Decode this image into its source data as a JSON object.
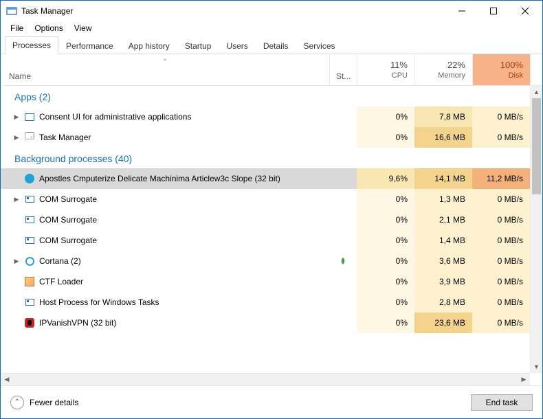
{
  "window": {
    "title": "Task Manager"
  },
  "menu": {
    "file": "File",
    "options": "Options",
    "view": "View"
  },
  "tabs": {
    "processes": "Processes",
    "performance": "Performance",
    "apphistory": "App history",
    "startup": "Startup",
    "users": "Users",
    "details": "Details",
    "services": "Services"
  },
  "columns": {
    "name": "Name",
    "status": "St...",
    "cpu_pct": "11%",
    "cpu_lbl": "CPU",
    "mem_pct": "22%",
    "mem_lbl": "Memory",
    "disk_pct": "100%",
    "disk_lbl": "Disk"
  },
  "groups": {
    "apps": "Apps (2)",
    "bg": "Background processes (40)"
  },
  "rows": {
    "consent": {
      "name": "Consent UI for administrative applications",
      "cpu": "0%",
      "mem": "7,8 MB",
      "disk": "0 MB/s"
    },
    "tm": {
      "name": "Task Manager",
      "cpu": "0%",
      "mem": "16,6 MB",
      "disk": "0 MB/s"
    },
    "apostles": {
      "name": "Apostles Cmputerize Delicate Machinima Articlew3c Slope (32 bit)",
      "cpu": "9,6%",
      "mem": "14,1 MB",
      "disk": "11,2 MB/s"
    },
    "com1": {
      "name": "COM Surrogate",
      "cpu": "0%",
      "mem": "1,3 MB",
      "disk": "0 MB/s"
    },
    "com2": {
      "name": "COM Surrogate",
      "cpu": "0%",
      "mem": "2,1 MB",
      "disk": "0 MB/s"
    },
    "com3": {
      "name": "COM Surrogate",
      "cpu": "0%",
      "mem": "1,4 MB",
      "disk": "0 MB/s"
    },
    "cortana": {
      "name": "Cortana (2)",
      "cpu": "0%",
      "mem": "3,6 MB",
      "disk": "0 MB/s"
    },
    "ctf": {
      "name": "CTF Loader",
      "cpu": "0%",
      "mem": "3,9 MB",
      "disk": "0 MB/s"
    },
    "host": {
      "name": "Host Process for Windows Tasks",
      "cpu": "0%",
      "mem": "2,8 MB",
      "disk": "0 MB/s"
    },
    "ipv": {
      "name": "IPVanishVPN (32 bit)",
      "cpu": "0%",
      "mem": "23,6 MB",
      "disk": "0 MB/s"
    }
  },
  "footer": {
    "fewer": "Fewer details",
    "end": "End task"
  }
}
